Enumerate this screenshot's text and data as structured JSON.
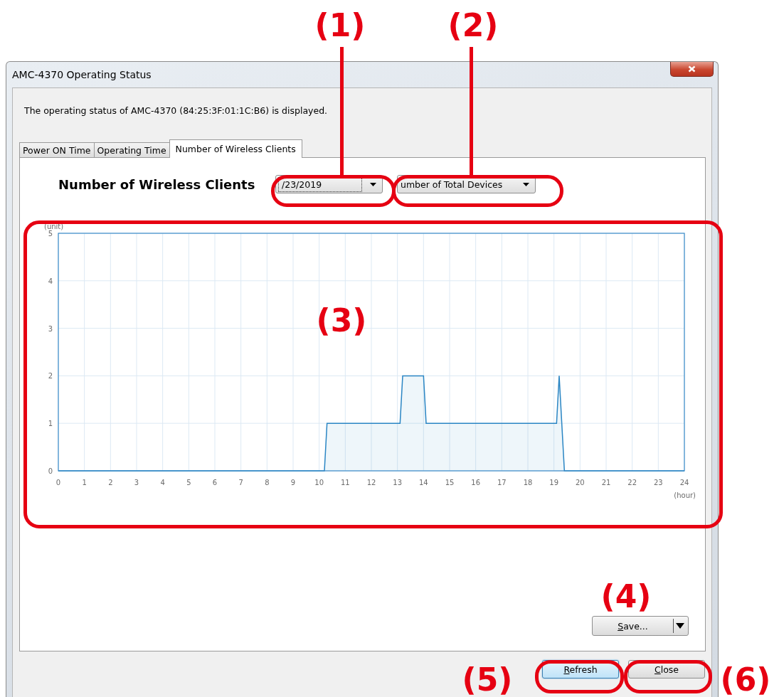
{
  "window": {
    "title": "AMC-4370 Operating Status"
  },
  "description": "The operating status of AMC-4370 (84:25:3F:01:1C:B6) is displayed.",
  "tabs": [
    {
      "label": "Power ON Time",
      "selected": false
    },
    {
      "label": "Operating Time",
      "selected": false
    },
    {
      "label": "Number of Wireless Clients",
      "selected": true
    }
  ],
  "panel": {
    "heading": "Number of Wireless Clients",
    "date_select": {
      "value": "/23/2019"
    },
    "metric_select": {
      "value": "umber of Total Devices"
    },
    "chart_data": {
      "type": "area",
      "xlabel": "(hour)",
      "ylabel": "(unit)",
      "x": [
        0,
        10.2,
        10.3,
        13.1,
        13.2,
        14.0,
        14.1,
        19.1,
        19.2,
        19.4,
        24
      ],
      "series": [
        {
          "color": "#2b86c4",
          "values": [
            0,
            0,
            1,
            1,
            2,
            2,
            1,
            1,
            2,
            0,
            0
          ]
        }
      ],
      "xlim": [
        0,
        24
      ],
      "ylim": [
        0,
        5
      ],
      "grid": true,
      "xticks": [
        0,
        1,
        2,
        3,
        4,
        5,
        6,
        7,
        8,
        9,
        10,
        11,
        12,
        13,
        14,
        15,
        16,
        17,
        18,
        19,
        20,
        21,
        22,
        23,
        24
      ],
      "yticks": [
        0,
        1,
        2,
        3,
        4,
        5
      ]
    },
    "save_button": "Save..."
  },
  "buttons": [
    {
      "label": "Refresh",
      "default": true
    },
    {
      "label": "Close",
      "default": false
    }
  ],
  "callouts": [
    {
      "label": "(1)"
    },
    {
      "label": "(2)"
    },
    {
      "label": "(3)"
    },
    {
      "label": "(4)"
    },
    {
      "label": "(5)"
    },
    {
      "label": "(6)"
    }
  ]
}
